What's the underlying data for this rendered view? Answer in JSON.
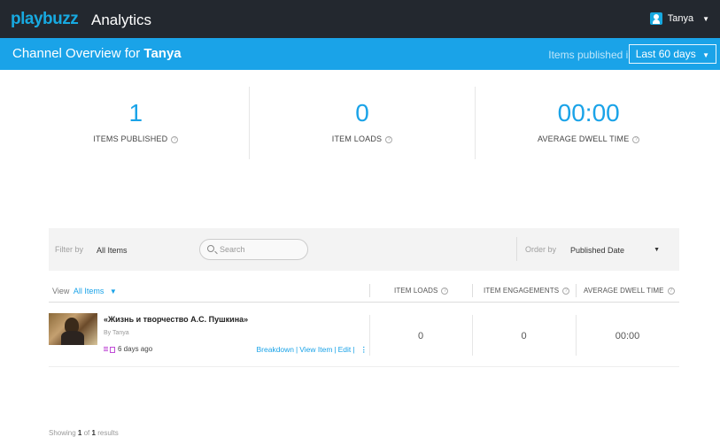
{
  "header": {
    "brand": "playbuzz",
    "app_name": "Analytics",
    "user_name": "Tanya"
  },
  "channel": {
    "title_prefix": "Channel Overview for",
    "title_name": "Tanya",
    "published_in_label": "Items published in",
    "range_label": "Last 60 days"
  },
  "stats": [
    {
      "value": "1",
      "label": "ITEMS PUBLISHED"
    },
    {
      "value": "0",
      "label": "ITEM LOADS"
    },
    {
      "value": "00:00",
      "label": "AVERAGE DWELL TIME"
    }
  ],
  "filters": {
    "filter_label": "Filter by",
    "filter_value": "All Items",
    "search_placeholder": "Search",
    "order_label": "Order by",
    "order_value": "Published Date"
  },
  "table": {
    "view_label": "View",
    "view_value": "All Items",
    "columns": [
      "ITEM LOADS",
      "ITEM ENGAGEMENTS",
      "AVERAGE DWELL TIME"
    ],
    "rows": [
      {
        "title": "«Жизнь и творчество А.С. Пушкина»",
        "author": "By Tanya",
        "age": "6 days ago",
        "actions": [
          "Breakdown",
          "View Item",
          "Edit"
        ],
        "item_loads": "0",
        "item_engagements": "0",
        "dwell_time": "00:00"
      }
    ]
  },
  "footer": {
    "showing_prefix": "Showing",
    "showing_from": "1",
    "showing_of": "of",
    "showing_total": "1",
    "showing_suffix": "results"
  },
  "colors": {
    "accent": "#1aa3e8",
    "topbar": "#23282f",
    "type_icon": "#c04bd6"
  }
}
